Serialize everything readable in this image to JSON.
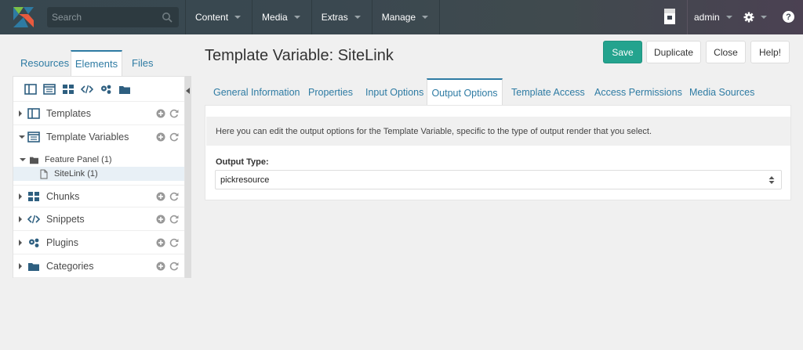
{
  "header": {
    "search_placeholder": "Search",
    "nav": [
      {
        "label": "Content"
      },
      {
        "label": "Media"
      },
      {
        "label": "Extras"
      },
      {
        "label": "Manage"
      }
    ],
    "user": "admin",
    "help": "?"
  },
  "left_panel": {
    "tabs": [
      "Resources",
      "Elements",
      "Files"
    ],
    "active_tab": "Elements",
    "tree": [
      {
        "label": "Templates",
        "icon": "template-icon",
        "expanded": false
      },
      {
        "label": "Template Variables",
        "icon": "tv-icon",
        "expanded": true
      },
      {
        "label": "Chunks",
        "icon": "chunk-icon",
        "expanded": false
      },
      {
        "label": "Snippets",
        "icon": "code-icon",
        "expanded": false
      },
      {
        "label": "Plugins",
        "icon": "plugin-icon",
        "expanded": false
      },
      {
        "label": "Categories",
        "icon": "folder-icon",
        "expanded": false
      }
    ],
    "tv_children": {
      "folder": "Feature Panel (1)",
      "item": "SiteLink (1)"
    }
  },
  "main": {
    "title": "Template Variable: SiteLink",
    "buttons": {
      "save": "Save",
      "duplicate": "Duplicate",
      "close": "Close",
      "help": "Help!"
    },
    "tabs": [
      "General Information",
      "Properties",
      "Input Options",
      "Output Options",
      "Template Access",
      "Access Permissions",
      "Media Sources"
    ],
    "active_tab": "Output Options",
    "description": "Here you can edit the output options for the Template Variable, specific to the type of output render that you select.",
    "output_type_label": "Output Type:",
    "output_type_value": "pickresource"
  },
  "colors": {
    "accent": "#2e7ba3",
    "save": "#24a38e",
    "topbar": "#37474f"
  }
}
